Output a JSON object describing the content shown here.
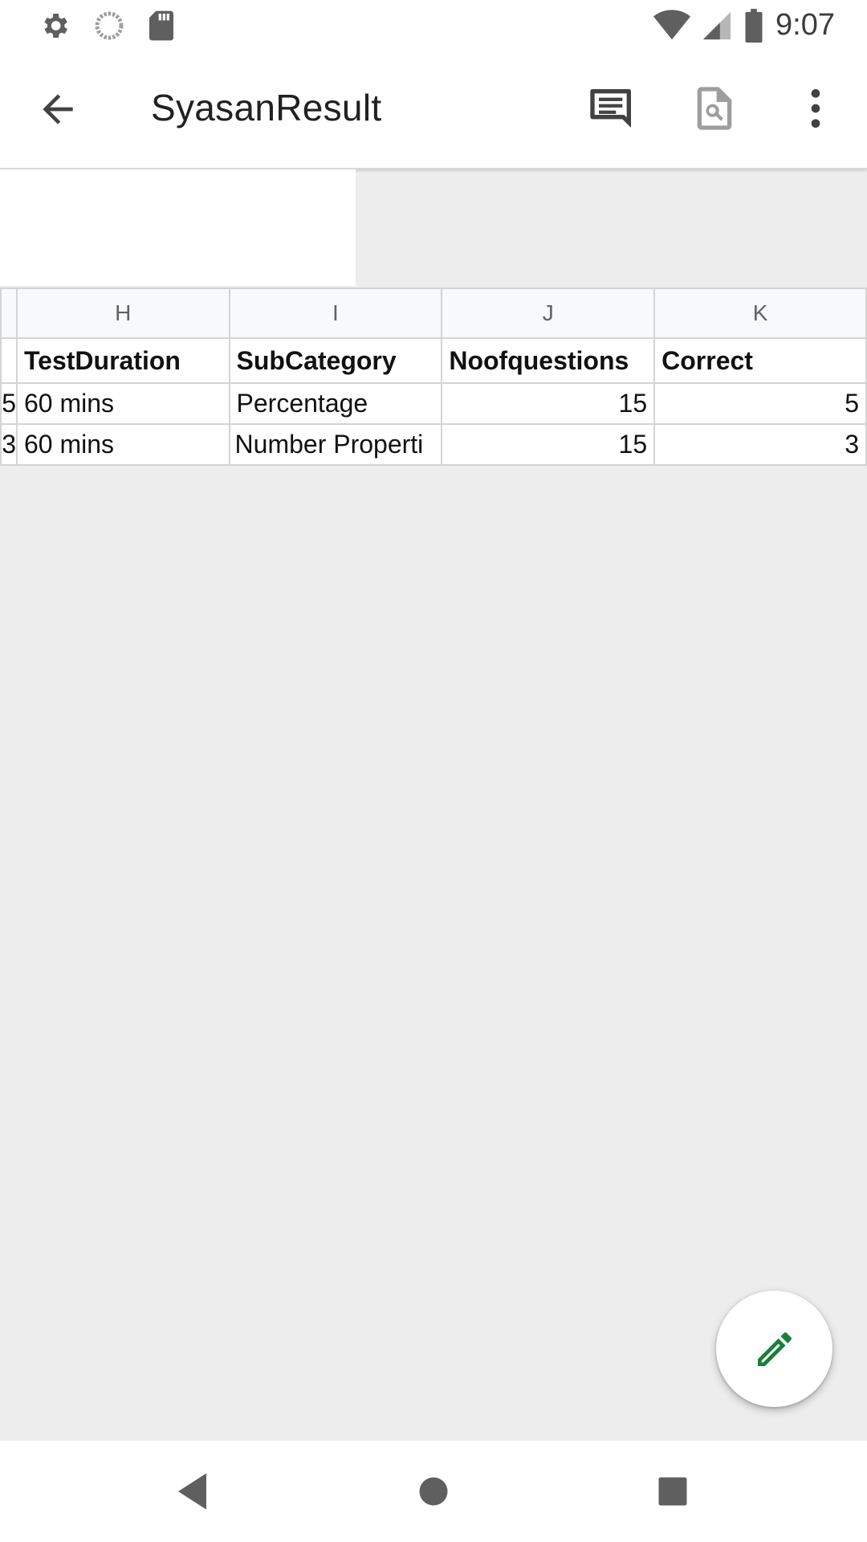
{
  "status_bar": {
    "time": "9:07",
    "left_icons": [
      "settings-icon",
      "loading-icon",
      "sd-card-icon"
    ],
    "right_icons": [
      "wifi-icon",
      "signal-icon",
      "battery-icon"
    ]
  },
  "app_bar": {
    "title": "SyasanResult",
    "actions": [
      "comments-icon",
      "find-in-doc-icon",
      "more-options-icon"
    ]
  },
  "sheet": {
    "column_headers": [
      "H",
      "I",
      "J",
      "K"
    ],
    "header_row": {
      "partial": "",
      "cells": [
        "TestDuration",
        "SubCategory",
        "Noofquestions",
        "Correct"
      ]
    },
    "rows": [
      {
        "partial": "5",
        "cells": [
          "60 mins",
          "Percentage",
          "15",
          "5"
        ]
      },
      {
        "partial": "3",
        "cells": [
          "60 mins",
          "Number Properti",
          "15",
          "3"
        ]
      }
    ]
  },
  "fab": {
    "icon": "edit-pencil-icon"
  },
  "nav_bar": {
    "buttons": [
      "back-triangle-icon",
      "home-circle-icon",
      "recents-square-icon"
    ]
  },
  "colors": {
    "fab_icon": "#188038",
    "header_bg": "#f8f9fa",
    "grid_line": "#d4d4d4"
  }
}
